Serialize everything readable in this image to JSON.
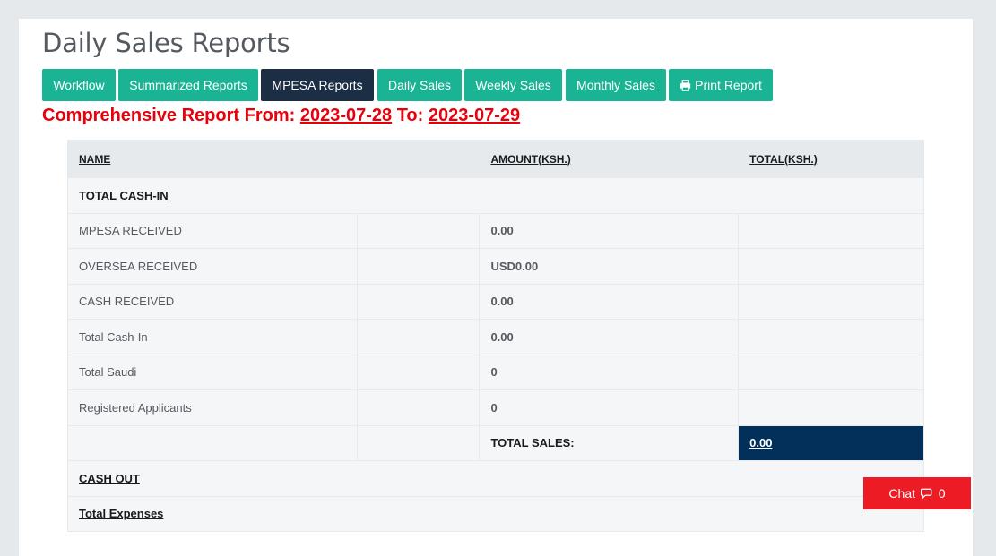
{
  "page": {
    "title": "Daily Sales Reports"
  },
  "nav_buttons": [
    {
      "label": "Workflow"
    },
    {
      "label": "Summarized Reports"
    },
    {
      "label": "MPESA Reports"
    },
    {
      "label": "Daily Sales"
    },
    {
      "label": "Weekly Sales"
    },
    {
      "label": "Monthly Sales"
    },
    {
      "label": "Print Report",
      "icon": "print-icon"
    }
  ],
  "report": {
    "prefix": "Comprehensive Report From:",
    "from_date": "2023-07-28",
    "to_label": "To:",
    "to_date": "2023-07-29"
  },
  "table": {
    "headers": {
      "name": "NAME",
      "blank": " ",
      "amount": "AMOUNT(KSH.)",
      "total": "TOTAL(KSH.)"
    },
    "section_cash_in": "TOTAL CASH-IN",
    "rows": [
      {
        "name": "MPESA RECEIVED",
        "amount": "0.00"
      },
      {
        "name": "OVERSEA RECEIVED",
        "amount": "USD0.00"
      },
      {
        "name": "CASH RECEIVED",
        "amount": "0.00"
      },
      {
        "name": "Total Cash-In",
        "amount": "0.00"
      },
      {
        "name": "Total Saudi",
        "amount": "0"
      },
      {
        "name": "Registered Applicants",
        "amount": "0"
      }
    ],
    "total_sales_label": "TOTAL SALES:",
    "total_sales_value": "0.00",
    "section_cash_out": "CASH OUT",
    "section_expenses": "Total Expenses"
  },
  "chat": {
    "label": "Chat",
    "count": "0",
    "icon": "comments-icon"
  },
  "colors": {
    "accent": "#1ab394",
    "active_button": "#1c2e44",
    "report_red": "#e8000b",
    "total_cell": "#03305a",
    "chat_button": "#ed1c24"
  }
}
